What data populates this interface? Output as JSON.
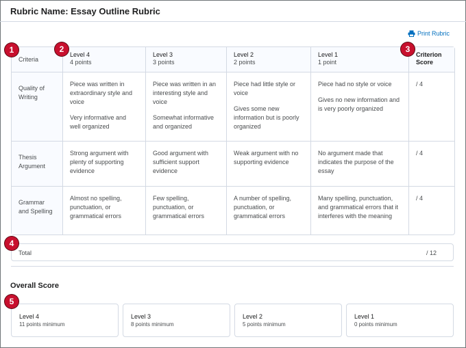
{
  "rubric": {
    "title": "Rubric Name: Essay Outline Rubric",
    "print_label": "Print Rubric",
    "criteria_header": "Criteria",
    "criterion_score_header": "Criterion Score",
    "levels": [
      {
        "name": "Level 4",
        "points": "4 points"
      },
      {
        "name": "Level 3",
        "points": "3 points"
      },
      {
        "name": "Level 2",
        "points": "2 points"
      },
      {
        "name": "Level 1",
        "points": "1 point"
      }
    ],
    "criteria": [
      {
        "name": "Quality of Writing",
        "descriptions": [
          [
            "Piece was written in extraordinary style and voice",
            "Very informative and well organized"
          ],
          [
            "Piece was written in an interesting style and voice",
            "Somewhat informative and organized"
          ],
          [
            "Piece had little style or voice",
            "Gives some new information but is poorly organized"
          ],
          [
            "Piece had no style or voice",
            "Gives no new information and is very poorly organized"
          ]
        ],
        "score": "/ 4"
      },
      {
        "name": "Thesis Argument",
        "descriptions": [
          [
            "Strong argument with plenty of supporting evidence"
          ],
          [
            "Good argument with sufficient support evidence"
          ],
          [
            "Weak argument with no supporting evidence"
          ],
          [
            "No argument made that indicates the purpose of the essay"
          ]
        ],
        "score": "/ 4"
      },
      {
        "name": "Grammar and Spelling",
        "descriptions": [
          [
            "Almost no spelling, punctuation, or grammatical errors"
          ],
          [
            "Few spelling, punctuation, or grammatical errors"
          ],
          [
            "A number of spelling, punctuation, or grammatical errors"
          ],
          [
            "Many spelling, punctuation, and grammatical errors that it interferes with the meaning"
          ]
        ],
        "score": "/ 4"
      }
    ],
    "total_label": "Total",
    "total_value": "/ 12"
  },
  "overall": {
    "title": "Overall Score",
    "levels": [
      {
        "name": "Level 4",
        "minimum": "11 points minimum"
      },
      {
        "name": "Level 3",
        "minimum": "8 points minimum"
      },
      {
        "name": "Level 2",
        "minimum": "5 points minimum"
      },
      {
        "name": "Level 1",
        "minimum": "0 points minimum"
      }
    ]
  },
  "markers": [
    "1",
    "2",
    "3",
    "4",
    "5"
  ],
  "colors": {
    "marker": "#c8102e",
    "link": "#006fbf",
    "border": "#d3d9e3",
    "header_bg": "#f9fbff"
  }
}
